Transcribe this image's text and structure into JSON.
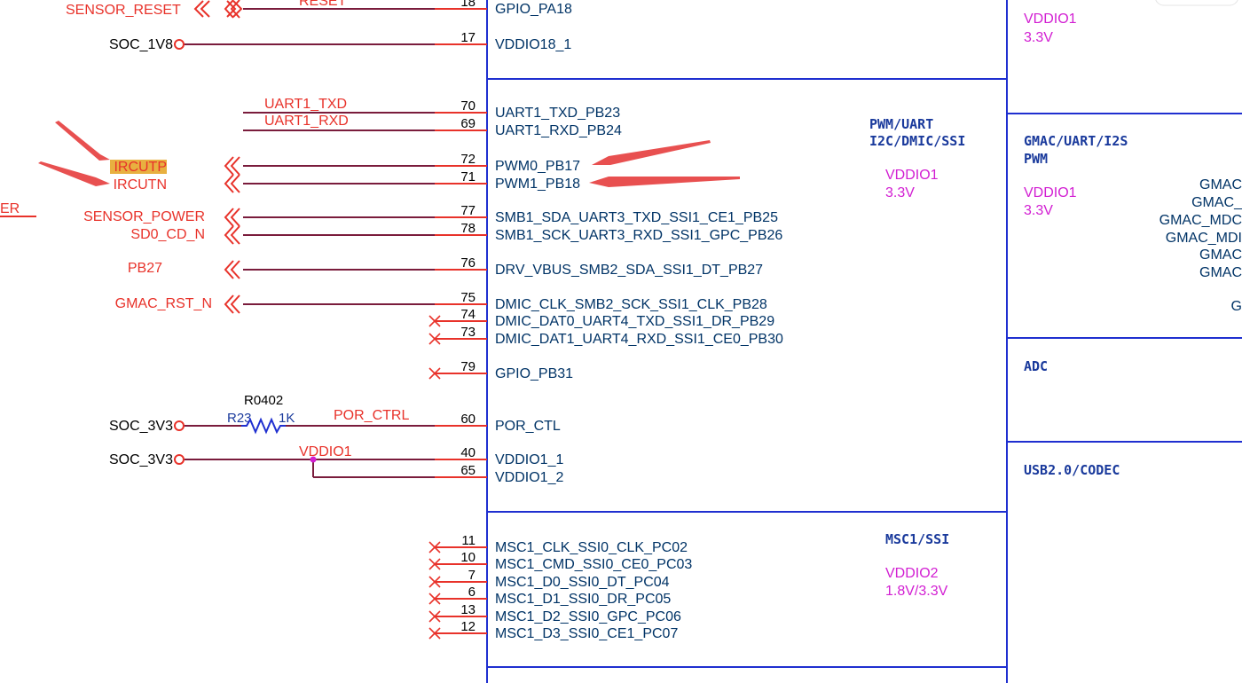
{
  "sections": [
    {
      "id": "pwm",
      "lines": [
        "PWM/UART",
        "I2C/DMIC/SSI"
      ],
      "vdd": [
        "VDDIO1",
        "3.3V"
      ]
    },
    {
      "id": "msc",
      "lines": [
        "MSC1/SSI"
      ],
      "vdd": [
        "VDDIO2",
        "1.8V/3.3V"
      ]
    },
    {
      "id": "right_top",
      "lines": [],
      "vdd": [
        "VDDIO1",
        "3.3V"
      ]
    },
    {
      "id": "gmac",
      "lines": [
        "GMAC/UART/I2S",
        "PWM"
      ],
      "vdd": [
        "VDDIO1",
        "3.3V"
      ]
    },
    {
      "id": "adc",
      "lines": [
        "ADC"
      ],
      "vdd": []
    },
    {
      "id": "usb",
      "lines": [
        "USB2.0/CODEC"
      ],
      "vdd": []
    }
  ],
  "gmac_pins": [
    "GMAC",
    "GMAC_",
    "GMAC_MDC",
    "GMAC_MDI",
    "GMAC",
    "GMAC",
    "G"
  ],
  "pins": [
    {
      "num": "18",
      "name": "GPIO_PA18",
      "net": "RESET",
      "ext": "SENSOR_RESET",
      "conn": "doubleport"
    },
    {
      "num": "17",
      "name": "VDDIO18_1",
      "net": "",
      "ext": "SOC_1V8",
      "conn": "circle"
    },
    {
      "num": "70",
      "name": "UART1_TXD_PB23",
      "net": "UART1_TXD",
      "ext": "",
      "conn": "wire"
    },
    {
      "num": "69",
      "name": "UART1_RXD_PB24",
      "net": "UART1_RXD",
      "ext": "",
      "conn": "wire"
    },
    {
      "num": "72",
      "name": "PWM0_PB17",
      "net": "",
      "ext": "IRCUTP",
      "conn": "port"
    },
    {
      "num": "71",
      "name": "PWM1_PB18",
      "net": "",
      "ext": "IRCUTN",
      "conn": "port"
    },
    {
      "num": "77",
      "name": "SMB1_SDA_UART3_TXD_SSI1_CE1_PB25",
      "net": "",
      "ext": "SENSOR_POWER",
      "conn": "port"
    },
    {
      "num": "78",
      "name": "SMB1_SCK_UART3_RXD_SSI1_GPC_PB26",
      "net": "",
      "ext": "SD0_CD_N",
      "conn": "port"
    },
    {
      "num": "76",
      "name": "DRV_VBUS_SMB2_SDA_SSI1_DT_PB27",
      "net": "",
      "ext": "PB27",
      "conn": "port"
    },
    {
      "num": "75",
      "name": "DMIC_CLK_SMB2_SCK_SSI1_CLK_PB28",
      "net": "",
      "ext": "GMAC_RST_N",
      "conn": "port"
    },
    {
      "num": "74",
      "name": "DMIC_DAT0_UART4_TXD_SSI1_DR_PB29",
      "net": "",
      "ext": "",
      "conn": "nc"
    },
    {
      "num": "73",
      "name": "DMIC_DAT1_UART4_RXD_SSI1_CE0_PB30",
      "net": "",
      "ext": "",
      "conn": "nc"
    },
    {
      "num": "79",
      "name": "GPIO_PB31",
      "net": "",
      "ext": "",
      "conn": "nc"
    },
    {
      "num": "60",
      "name": "POR_CTL",
      "net": "POR_CTRL",
      "ext": "SOC_3V3",
      "conn": "resistor"
    },
    {
      "num": "40",
      "name": "VDDIO1_1",
      "net": "VDDIO1",
      "ext": "SOC_3V3",
      "conn": "circle"
    },
    {
      "num": "65",
      "name": "VDDIO1_2",
      "net": "",
      "ext": "",
      "conn": "junction"
    },
    {
      "num": "11",
      "name": "MSC1_CLK_SSI0_CLK_PC02",
      "net": "",
      "ext": "",
      "conn": "nc"
    },
    {
      "num": "10",
      "name": "MSC1_CMD_SSI0_CE0_PC03",
      "net": "",
      "ext": "",
      "conn": "nc"
    },
    {
      "num": "7",
      "name": "MSC1_D0_SSI0_DT_PC04",
      "net": "",
      "ext": "",
      "conn": "nc"
    },
    {
      "num": "6",
      "name": "MSC1_D1_SSI0_DR_PC05",
      "net": "",
      "ext": "",
      "conn": "nc"
    },
    {
      "num": "13",
      "name": "MSC1_D2_SSI0_GPC_PC06",
      "net": "",
      "ext": "",
      "conn": "nc"
    },
    {
      "num": "12",
      "name": "MSC1_D3_SSI0_CE1_PC07",
      "net": "",
      "ext": "",
      "conn": "nc"
    }
  ],
  "resistor": {
    "footprint": "R0402",
    "ref": "R23",
    "value": "1K"
  },
  "partial_label": "ER",
  "colors": {
    "net": "#e8322a",
    "pin": "#003366",
    "box": "#1f2fd0",
    "power": "#d21ed2",
    "wire": "#7a1c3c"
  }
}
